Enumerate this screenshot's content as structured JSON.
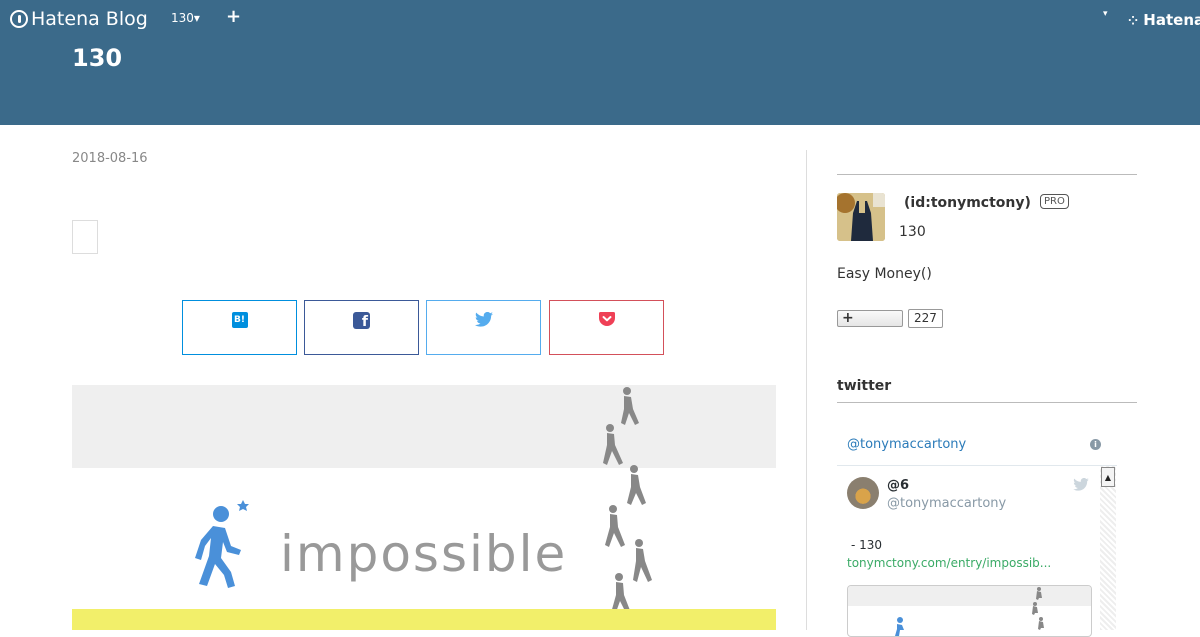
{
  "header": {
    "logo_text": "Hatena Blog",
    "blog_menu": "130▾",
    "add_label": "+",
    "user_caret": "▾",
    "hatena_text": "Hatena",
    "blog_title": "130",
    "bg_color": "#3b6a8a"
  },
  "entry": {
    "date": "2018-08-16",
    "share_buttons": [
      {
        "icon": "hatena-bookmark-icon",
        "label": "B!",
        "color": "#008fde"
      },
      {
        "icon": "facebook-icon",
        "label": "f",
        "color": "#3b5998"
      },
      {
        "icon": "twitter-icon",
        "color": "#55acee"
      },
      {
        "icon": "pocket-icon",
        "color": "#d3505a"
      }
    ],
    "image_word": "impossible"
  },
  "sidebar": {
    "profile": {
      "id": "(id:tonymctony)",
      "badge": "PRO",
      "name": "130",
      "description": "Easy Money()",
      "follow_label": "+",
      "follow_count": "227"
    },
    "twitter": {
      "heading": "twitter",
      "widget_account": "@tonymaccartony",
      "info_label": "i",
      "tweet": {
        "name": "@6",
        "handle": "@tonymaccartony",
        "text": "- 130",
        "link": "tonymctony.com/entry/impossib..."
      }
    }
  }
}
